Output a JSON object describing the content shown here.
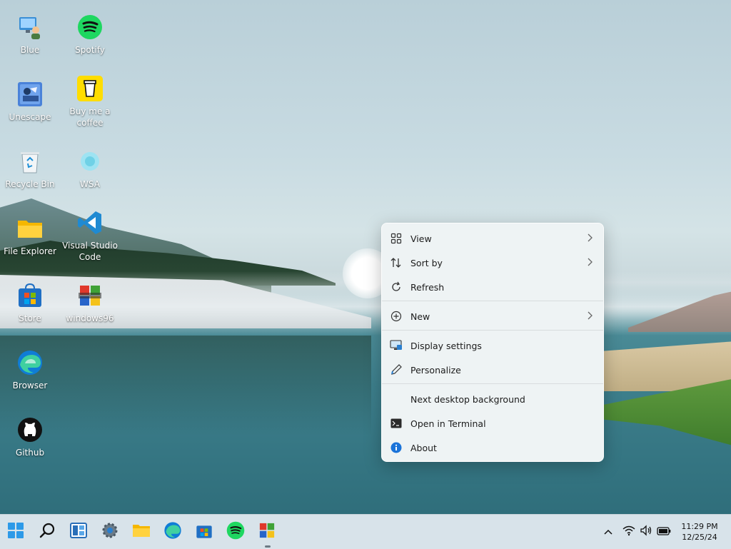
{
  "desktop": {
    "icons": [
      {
        "label": "Blue",
        "icon": "user-computer-icon"
      },
      {
        "label": "Spotify",
        "icon": "spotify-icon"
      },
      {
        "label": "Unescape",
        "icon": "unescape-app-icon"
      },
      {
        "label": "Buy me a coffee",
        "icon": "coffee-cup-icon"
      },
      {
        "label": "Recycle Bin",
        "icon": "recycle-bin-icon"
      },
      {
        "label": "WSA",
        "icon": "wsa-icon"
      },
      {
        "label": "File Explorer",
        "icon": "folder-icon"
      },
      {
        "label": "Visual Studio Code",
        "icon": "vscode-icon"
      },
      {
        "label": "Store",
        "icon": "store-bag-icon"
      },
      {
        "label": "windows96",
        "icon": "windows96-icon"
      },
      {
        "label": "Browser",
        "icon": "edge-icon"
      },
      {
        "label": "Github",
        "icon": "github-icon"
      }
    ]
  },
  "context_menu": {
    "items": [
      {
        "label": "View",
        "icon": "grid-view-icon",
        "submenu": true
      },
      {
        "label": "Sort by",
        "icon": "sort-arrows-icon",
        "submenu": true
      },
      {
        "label": "Refresh",
        "icon": "refresh-icon",
        "submenu": false
      },
      {
        "label": "New",
        "icon": "plus-circle-icon",
        "submenu": true
      },
      {
        "label": "Display settings",
        "icon": "monitor-icon",
        "submenu": false
      },
      {
        "label": "Personalize",
        "icon": "pen-icon",
        "submenu": false
      },
      {
        "label": "Next desktop background",
        "icon": "",
        "submenu": false
      },
      {
        "label": "Open in Terminal",
        "icon": "terminal-icon",
        "submenu": false
      },
      {
        "label": "About",
        "icon": "info-icon",
        "submenu": false
      }
    ]
  },
  "taskbar": {
    "apps": [
      {
        "name": "start",
        "icon": "windows-start-icon"
      },
      {
        "name": "search",
        "icon": "search-icon"
      },
      {
        "name": "widgets",
        "icon": "widgets-icon"
      },
      {
        "name": "settings",
        "icon": "gear-icon"
      },
      {
        "name": "file-explorer",
        "icon": "folder-icon"
      },
      {
        "name": "edge",
        "icon": "edge-icon"
      },
      {
        "name": "store",
        "icon": "store-bag-icon"
      },
      {
        "name": "spotify",
        "icon": "spotify-icon"
      },
      {
        "name": "windows96",
        "icon": "windows96-icon"
      }
    ],
    "tray": {
      "icons": [
        "chevron-up-icon",
        "wifi-icon",
        "volume-icon",
        "battery-icon"
      ],
      "time": "11:29 PM",
      "date": "12/25/24"
    }
  },
  "colors": {
    "accent": "#0067c0",
    "spotify": "#1ed760",
    "taskbar_bg": "#d8e3ea",
    "menu_bg": "#eef3f4"
  }
}
